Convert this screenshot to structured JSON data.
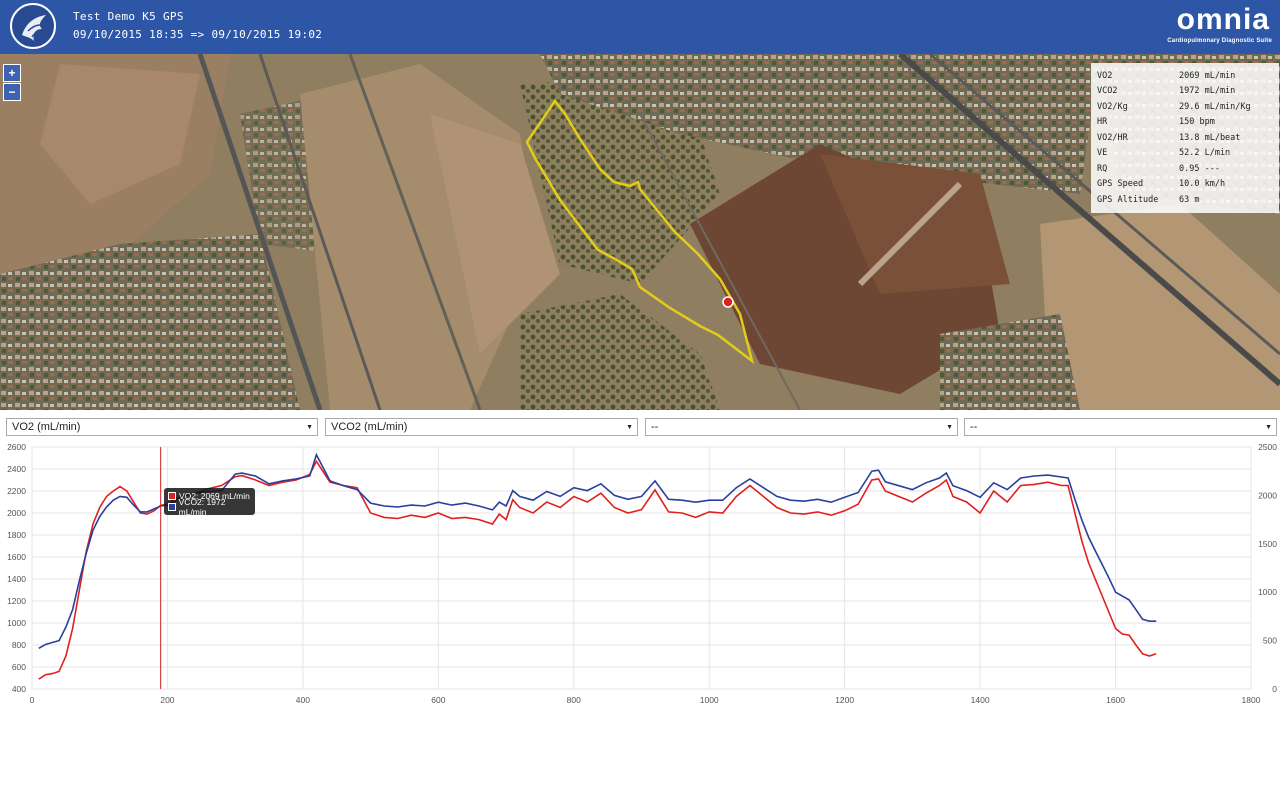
{
  "header": {
    "title": "Test Demo K5 GPS",
    "time_range": "09/10/2015 18:35 => 09/10/2015 19:02",
    "brand": "omnia",
    "tagline": "Cardiopulmonary Diagnostic Suite",
    "background_color": "#2e56a7"
  },
  "map": {
    "zoom_in_label": "+",
    "zoom_out_label": "−",
    "track_color": "#e2cc1a",
    "marker_color": "#e02020"
  },
  "metrics": [
    {
      "label": "VO2",
      "value": "2069 mL/min"
    },
    {
      "label": "VCO2",
      "value": "1972 mL/min"
    },
    {
      "label": "VO2/Kg",
      "value": "29.6 mL/min/Kg"
    },
    {
      "label": "HR",
      "value": "150 bpm"
    },
    {
      "label": "VO2/HR",
      "value": "13.8 mL/beat"
    },
    {
      "label": "VE",
      "value": "52.2 L/min"
    },
    {
      "label": "RQ",
      "value": "0.95 ---"
    },
    {
      "label": "GPS Speed",
      "value": "10.0 km/h"
    },
    {
      "label": "GPS Altitude",
      "value": "63 m"
    }
  ],
  "selectors": [
    {
      "value": "VO2 (mL/min)"
    },
    {
      "value": "VCO2 (mL/min)"
    },
    {
      "value": "--"
    },
    {
      "value": "--"
    }
  ],
  "tooltip": {
    "vo2": "VO2: 2069 mL/min",
    "vco2": "VCO2: 1972 mL/min"
  },
  "chart_data": {
    "type": "line",
    "xlim": [
      0,
      1800
    ],
    "x_ticks": [
      0,
      200,
      400,
      600,
      800,
      1000,
      1200,
      1400,
      1600,
      1800
    ],
    "y_left_lim": [
      400,
      2600
    ],
    "y_left_ticks": [
      400,
      600,
      800,
      1000,
      1200,
      1400,
      1600,
      1800,
      2000,
      2200,
      2400,
      2600
    ],
    "y_right_lim": [
      0,
      2500
    ],
    "y_right_ticks": [
      0,
      500,
      1000,
      1500,
      2000,
      2500
    ],
    "cursor_x": 190,
    "grid": true,
    "series": [
      {
        "name": "VO2",
        "axis": "left",
        "color": "#e02020",
        "x": [
          10,
          20,
          30,
          40,
          50,
          60,
          70,
          80,
          90,
          100,
          110,
          120,
          130,
          140,
          150,
          160,
          170,
          180,
          190,
          200,
          210,
          220,
          240,
          260,
          280,
          300,
          310,
          330,
          350,
          370,
          390,
          410,
          420,
          440,
          460,
          480,
          500,
          520,
          540,
          560,
          580,
          600,
          620,
          640,
          660,
          680,
          690,
          700,
          710,
          720,
          740,
          760,
          780,
          800,
          820,
          840,
          860,
          880,
          900,
          920,
          940,
          960,
          980,
          1000,
          1020,
          1040,
          1060,
          1080,
          1100,
          1120,
          1140,
          1160,
          1180,
          1200,
          1220,
          1240,
          1250,
          1260,
          1280,
          1300,
          1320,
          1340,
          1350,
          1360,
          1380,
          1400,
          1420,
          1440,
          1460,
          1480,
          1500,
          1520,
          1530,
          1540,
          1550,
          1560,
          1570,
          1580,
          1590,
          1600,
          1610,
          1620,
          1630,
          1640,
          1650,
          1660
        ],
        "y": [
          490,
          530,
          540,
          560,
          700,
          950,
          1300,
          1650,
          1900,
          2050,
          2150,
          2200,
          2240,
          2200,
          2100,
          2000,
          1990,
          2020,
          2069,
          2080,
          2100,
          2150,
          2180,
          2220,
          2250,
          2330,
          2340,
          2300,
          2250,
          2280,
          2300,
          2350,
          2470,
          2280,
          2250,
          2230,
          2000,
          1960,
          1950,
          1980,
          1960,
          2000,
          1950,
          1960,
          1940,
          1900,
          1990,
          1940,
          2120,
          2050,
          2000,
          2100,
          2050,
          2150,
          2100,
          2180,
          2050,
          2000,
          2030,
          2210,
          2010,
          2000,
          1960,
          2010,
          2000,
          2150,
          2250,
          2150,
          2050,
          2000,
          1990,
          2010,
          1980,
          2020,
          2080,
          2300,
          2310,
          2200,
          2150,
          2100,
          2180,
          2250,
          2300,
          2150,
          2100,
          2000,
          2200,
          2100,
          2250,
          2260,
          2280,
          2250,
          2250,
          2000,
          1750,
          1550,
          1400,
          1250,
          1100,
          950,
          900,
          890,
          800,
          720,
          700,
          720
        ]
      },
      {
        "name": "VCO2",
        "axis": "right",
        "color": "#2a3f9e",
        "x": [
          10,
          20,
          30,
          40,
          50,
          60,
          70,
          80,
          90,
          100,
          110,
          120,
          130,
          140,
          150,
          160,
          170,
          180,
          190,
          200,
          210,
          220,
          240,
          260,
          280,
          300,
          310,
          330,
          350,
          370,
          390,
          410,
          420,
          440,
          460,
          480,
          500,
          520,
          540,
          560,
          580,
          600,
          620,
          640,
          660,
          680,
          690,
          700,
          710,
          720,
          740,
          760,
          780,
          800,
          820,
          840,
          860,
          880,
          900,
          920,
          940,
          960,
          980,
          1000,
          1020,
          1040,
          1060,
          1080,
          1100,
          1120,
          1140,
          1160,
          1180,
          1200,
          1220,
          1240,
          1250,
          1260,
          1280,
          1300,
          1320,
          1340,
          1350,
          1360,
          1380,
          1400,
          1420,
          1440,
          1460,
          1480,
          1500,
          1520,
          1530,
          1540,
          1550,
          1560,
          1570,
          1580,
          1590,
          1600,
          1610,
          1620,
          1630,
          1640,
          1650,
          1660
        ],
        "y": [
          420,
          460,
          480,
          500,
          640,
          820,
          1120,
          1400,
          1640,
          1780,
          1880,
          1950,
          1990,
          1980,
          1900,
          1830,
          1830,
          1860,
          1890,
          1900,
          1960,
          1990,
          2020,
          2040,
          2050,
          2220,
          2230,
          2200,
          2120,
          2150,
          2170,
          2200,
          2420,
          2150,
          2100,
          2060,
          1920,
          1890,
          1880,
          1900,
          1890,
          1930,
          1900,
          1920,
          1890,
          1850,
          1930,
          1890,
          2050,
          1990,
          1950,
          2040,
          1990,
          2080,
          2050,
          2120,
          2000,
          1960,
          1990,
          2150,
          1960,
          1950,
          1930,
          1950,
          1950,
          2080,
          2170,
          2080,
          1990,
          1950,
          1940,
          1960,
          1930,
          1980,
          2030,
          2250,
          2260,
          2140,
          2100,
          2060,
          2130,
          2180,
          2230,
          2100,
          2050,
          1980,
          2130,
          2060,
          2180,
          2200,
          2210,
          2190,
          2180,
          1960,
          1750,
          1570,
          1430,
          1290,
          1150,
          1000,
          960,
          920,
          820,
          720,
          700,
          700
        ]
      }
    ]
  }
}
